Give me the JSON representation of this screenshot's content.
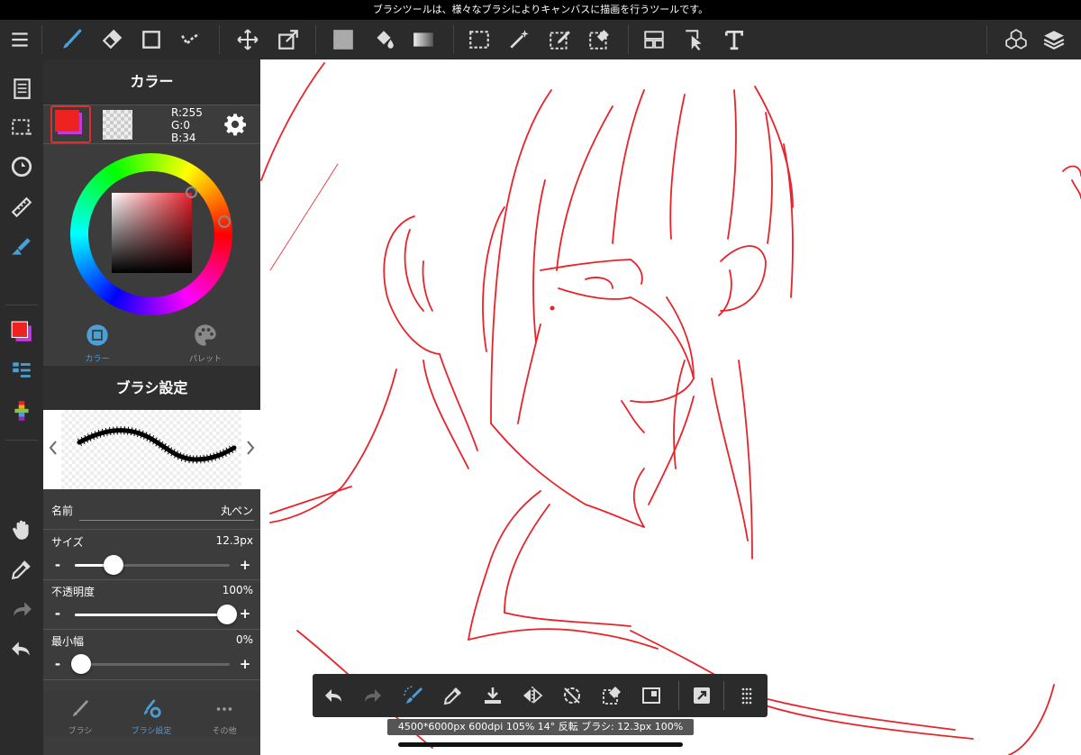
{
  "status_bar": {
    "text": "ブラシツールは、様々なブラシによりキャンバスに描画を行うツールです。"
  },
  "top_toolbar": {
    "icons": [
      "menu-icon",
      "brush-icon",
      "eraser-icon",
      "shape-icon",
      "dot-icon",
      "move-icon",
      "transform-icon",
      "fill-color-icon",
      "bucket-icon",
      "gradient-icon",
      "selection-icon",
      "magic-wand-icon",
      "select-pen-icon",
      "select-eraser-icon",
      "frame-icon",
      "operation-icon",
      "text-icon",
      "3d-icon",
      "layers-icon"
    ]
  },
  "color_panel": {
    "title": "カラー",
    "foreground_color": "#ef2222",
    "rgb": {
      "r": "R:255",
      "g": "G:0",
      "b": "B:34"
    },
    "tabs": [
      {
        "label": "カラー",
        "active": true
      },
      {
        "label": "パレット",
        "active": false
      }
    ],
    "accent": "#4a9fd8"
  },
  "brush_settings": {
    "title": "ブラシ設定",
    "name_label": "名前",
    "name_value": "丸ペン",
    "rows": [
      {
        "label": "サイズ",
        "value": "12.3px",
        "fraction": 0.25
      },
      {
        "label": "不透明度",
        "value": "100%",
        "fraction": 1.0
      },
      {
        "label": "最小幅",
        "value": "0%",
        "fraction": 0.0
      }
    ],
    "minus": "-",
    "plus": "+"
  },
  "bottom_tabs": [
    {
      "label": "ブラシ",
      "active": false
    },
    {
      "label": "ブラシ設定",
      "active": true
    },
    {
      "label": "その他",
      "active": false
    }
  ],
  "info_bar": {
    "text": "4500*6000px 600dpi 105% 14° 反転 ブラシ: 12.3px 100%"
  },
  "stroke_color": "#e8232a"
}
